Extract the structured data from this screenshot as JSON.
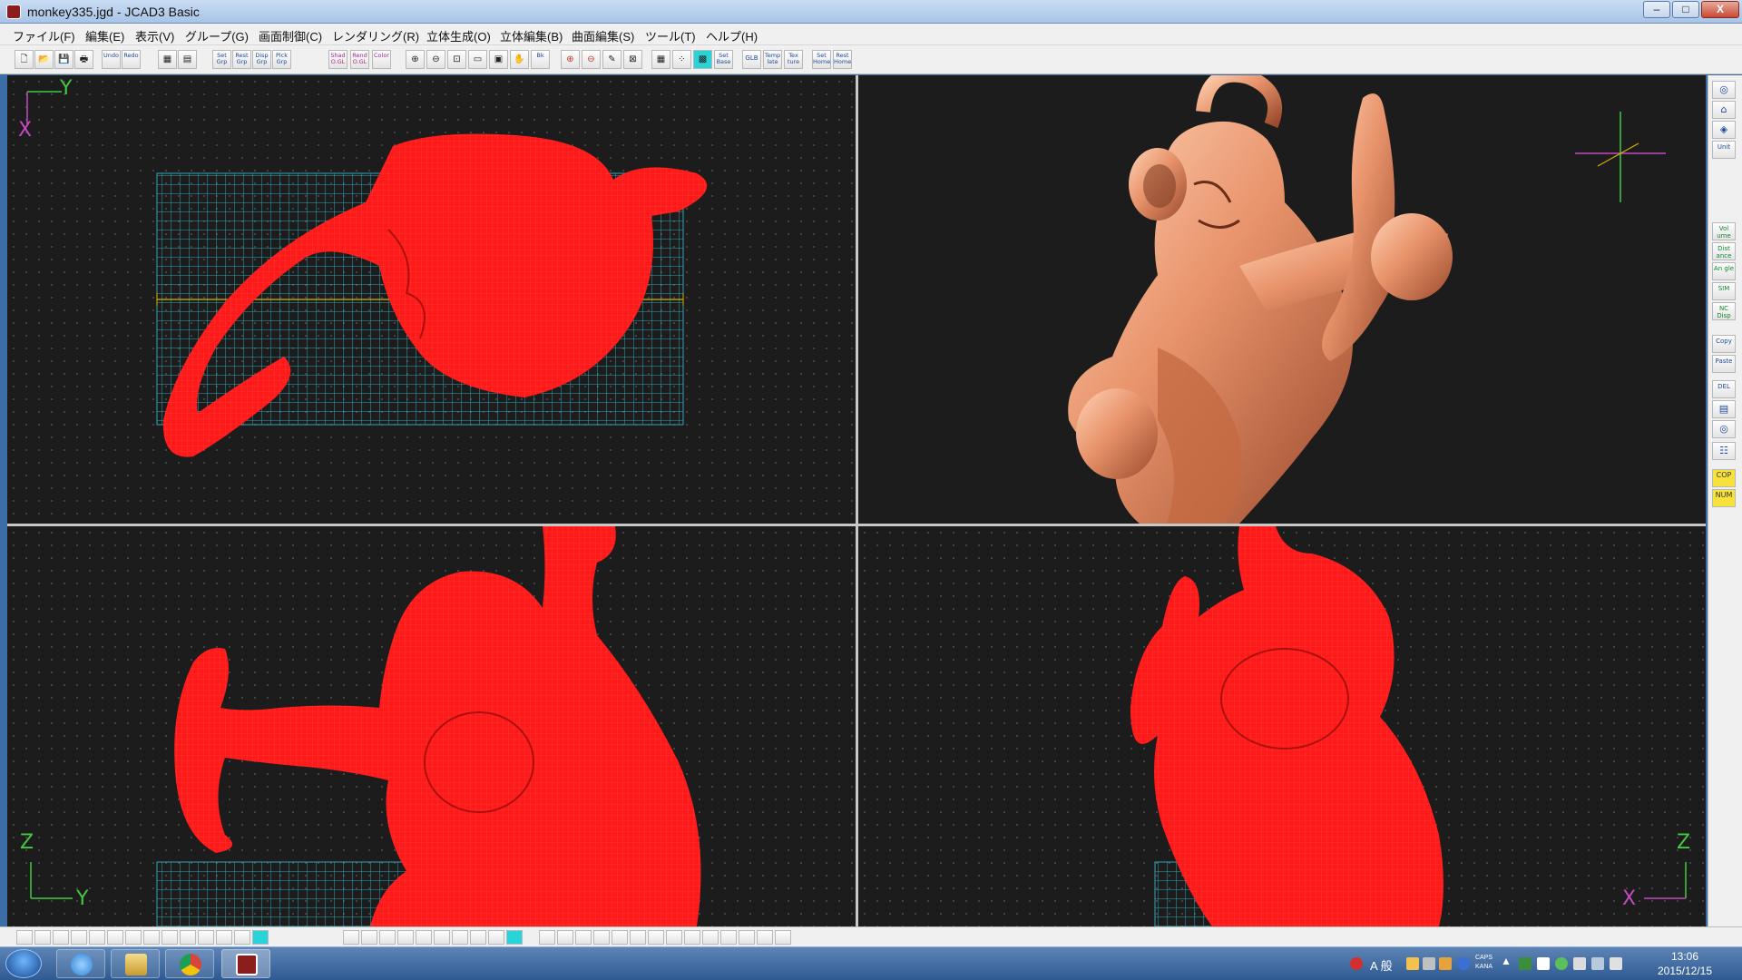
{
  "window": {
    "title": "monkey335.jgd - JCAD3 Basic",
    "minimize_glyph": "–",
    "maximize_glyph": "□",
    "close_glyph": "X"
  },
  "menu": {
    "items": [
      {
        "label": "ファイル(F)"
      },
      {
        "label": "編集(E)"
      },
      {
        "label": "表示(V)"
      },
      {
        "label": "グループ(G)"
      },
      {
        "label": "画面制御(C)"
      },
      {
        "label": "レンダリング(R)"
      },
      {
        "label": "立体生成(O)"
      },
      {
        "label": "立体編集(B)"
      },
      {
        "label": "曲面編集(S)"
      },
      {
        "label": "ツール(T)"
      },
      {
        "label": "ヘルプ(H)"
      }
    ]
  },
  "toolbar": {
    "buttons": [
      {
        "name": "new-file-icon",
        "label": "🗋"
      },
      {
        "name": "open-folder-icon",
        "label": "📂"
      },
      {
        "name": "save-icon",
        "label": "💾"
      },
      {
        "name": "print-icon",
        "label": "🖶"
      },
      {
        "name": "undo-button",
        "label": "Undo"
      },
      {
        "name": "redo-button",
        "label": "Redo"
      },
      {
        "name": "group-icon-1",
        "label": "▦"
      },
      {
        "name": "group-icon-2",
        "label": "▤"
      },
      {
        "name": "set-group-button",
        "label": "Set Grp"
      },
      {
        "name": "reset-group-button",
        "label": "Rest Grp"
      },
      {
        "name": "display-group-button",
        "label": "Disp Grp"
      },
      {
        "name": "pick-group-button",
        "label": "Pick Grp"
      },
      {
        "name": "shade-opengl-button",
        "label": "Shad O.GL"
      },
      {
        "name": "render-opengl-button",
        "label": "Rend O.GL"
      },
      {
        "name": "color-button",
        "label": "Color"
      },
      {
        "name": "zoom-in-icon",
        "label": "⊕"
      },
      {
        "name": "zoom-out-icon",
        "label": "⊖"
      },
      {
        "name": "zoom-window-icon",
        "label": "⊡"
      },
      {
        "name": "zoom-fit-icon",
        "label": "▭"
      },
      {
        "name": "zoom-all-icon",
        "label": "▣"
      },
      {
        "name": "pan-hand-icon",
        "label": "✋"
      },
      {
        "name": "back-view-icon",
        "label": "Bk"
      },
      {
        "name": "zoom-red-in-icon",
        "label": "⊕"
      },
      {
        "name": "zoom-red-out-icon",
        "label": "⊖"
      },
      {
        "name": "zoom-edit-icon",
        "label": "✎"
      },
      {
        "name": "zoom-box-icon",
        "label": "⊠"
      },
      {
        "name": "grid-icon",
        "label": "▦"
      },
      {
        "name": "snap-grid-icon",
        "label": "⁘"
      },
      {
        "name": "grid-toggle-icon",
        "label": "▩"
      },
      {
        "name": "set-base-button",
        "label": "Set Base"
      },
      {
        "name": "glb-button",
        "label": "GLB"
      },
      {
        "name": "template-button",
        "label": "Temp late"
      },
      {
        "name": "texture-button",
        "label": "Tex ture"
      },
      {
        "name": "set-home-button",
        "label": "Set Home"
      },
      {
        "name": "reset-home-button",
        "label": "Rest Home"
      }
    ]
  },
  "viewports": {
    "top": {
      "axis_v": "Y",
      "axis_h": "X"
    },
    "front": {
      "axis_v": "Z",
      "axis_h": "Y"
    },
    "side": {
      "axis_v": "Z",
      "axis_h": "X"
    }
  },
  "right_toolbar": {
    "buttons": [
      {
        "name": "view-icon-1",
        "label": "◎"
      },
      {
        "name": "view-icon-2",
        "label": "⌂"
      },
      {
        "name": "view-icon-3",
        "label": "◈"
      },
      {
        "name": "unit-button",
        "label": "Unit"
      },
      {
        "name": "volume-button",
        "label": "Vol ume"
      },
      {
        "name": "distance-button",
        "label": "Dist ance"
      },
      {
        "name": "angle-button",
        "label": "An gle"
      },
      {
        "name": "sim-button",
        "label": "SIM"
      },
      {
        "name": "nc-disp-button",
        "label": "NC Disp"
      },
      {
        "name": "copy-button",
        "label": "Copy"
      },
      {
        "name": "paste-button",
        "label": "Paste"
      },
      {
        "name": "delete-button",
        "label": "DEL"
      },
      {
        "name": "list-icon-1",
        "label": "▤"
      },
      {
        "name": "list-icon-2",
        "label": "◎"
      },
      {
        "name": "tree-icon",
        "label": "☷"
      },
      {
        "name": "cop-button",
        "label": "COP"
      },
      {
        "name": "num-button",
        "label": "NUM"
      }
    ]
  },
  "taskbar": {
    "apps": [
      {
        "name": "internet-explorer-icon",
        "color": "#2a86d8"
      },
      {
        "name": "file-explorer-icon",
        "color": "#e8c25a"
      },
      {
        "name": "chrome-icon",
        "color": "#d9453a"
      },
      {
        "name": "jcad-taskbar-icon",
        "color": "#8b1d1d"
      }
    ],
    "tray": {
      "ime_label": "A 般",
      "caps": "CAPS",
      "kana": "KANA"
    },
    "clock": {
      "time": "13:06",
      "date": "2015/12/15"
    }
  },
  "colors": {
    "wireframe": "#ff1a1a",
    "render_body": "#e8936b",
    "grid_cyan": "#2fa6b8",
    "axis_green": "#43c843",
    "axis_magenta": "#c34ac3",
    "axis_yellow": "#d9b000"
  }
}
